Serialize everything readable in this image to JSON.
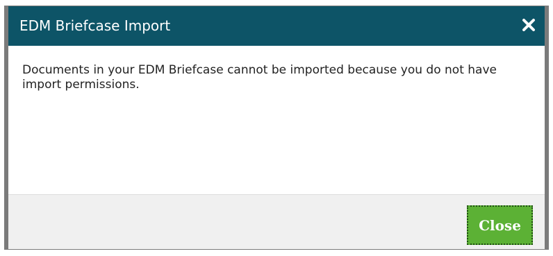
{
  "dialog": {
    "title": "EDM Briefcase Import",
    "close_icon": "close-icon",
    "message": "Documents in your EDM Briefcase cannot be imported because you do not have import permissions.",
    "close_button_label": "Close"
  },
  "colors": {
    "titlebar": "#0d5467",
    "title_text": "#ffffff",
    "footer": "#f0f0f0",
    "close_button": "#5cb135",
    "frame_border": "#7b7b7b"
  }
}
